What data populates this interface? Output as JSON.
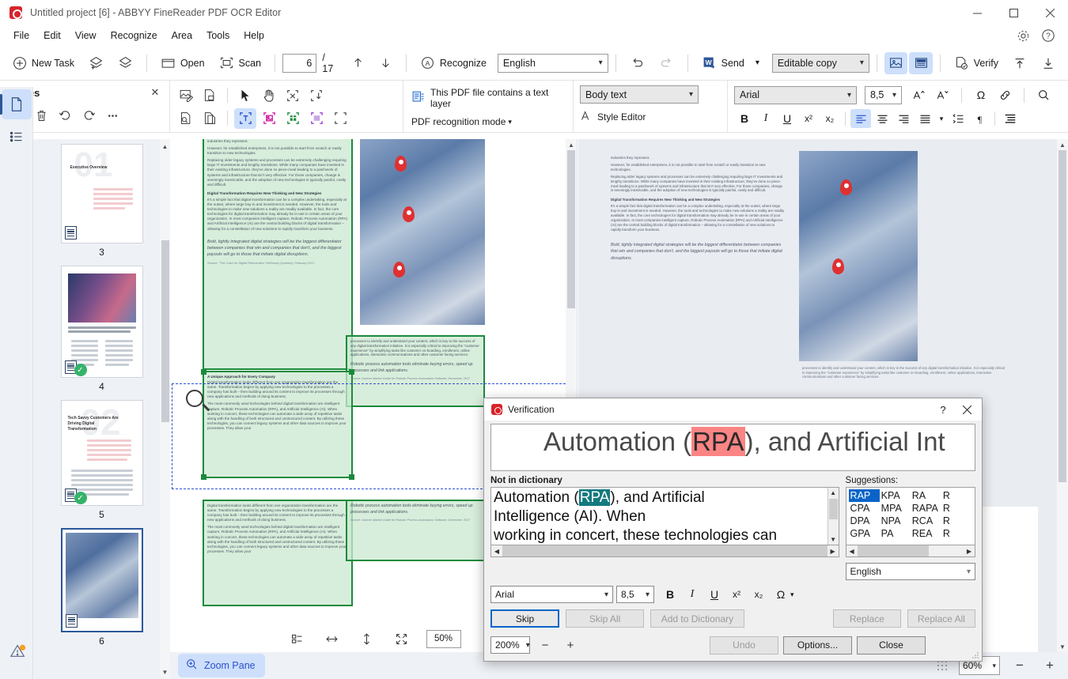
{
  "window": {
    "title": "Untitled project [6] - ABBYY FineReader PDF OCR Editor",
    "minimize": "─",
    "maximize": "☐",
    "close": "✕"
  },
  "menubar": {
    "items": [
      "File",
      "Edit",
      "View",
      "Recognize",
      "Area",
      "Tools",
      "Help"
    ],
    "settings_icon": "gear-icon",
    "help_icon": "help-icon"
  },
  "toolbar": {
    "new_task": "New Task",
    "open": "Open",
    "scan": "Scan",
    "page_current": "6",
    "page_total": "/ 17",
    "recognize": "Recognize",
    "language": "English",
    "send": "Send",
    "export_mode": "Editable copy",
    "verify": "Verify"
  },
  "panels": {
    "pages": {
      "title": "Pages",
      "close": "✕",
      "thumbnails": [
        {
          "number": "3",
          "title": "Executive Overview",
          "big_digit": "01",
          "verified": false
        },
        {
          "number": "4",
          "title": "",
          "big_digit": "",
          "verified": true
        },
        {
          "number": "5",
          "title": "Tech Savvy Customers Are Driving Digital Transformation",
          "big_digit": "02",
          "verified": true
        },
        {
          "number": "6",
          "title": "",
          "big_digit": "",
          "verified": false,
          "selected": true
        }
      ]
    },
    "pdf_mode": {
      "text_layer_note": "This PDF file contains a text layer",
      "recognition_mode": "PDF recognition mode"
    },
    "style": {
      "style_name": "Body text",
      "style_editor": "Style Editor"
    },
    "format": {
      "font": "Arial",
      "size": "8,5",
      "bold": "B",
      "italic": "I",
      "underline": "U",
      "superscript": "x²",
      "subscript": "x₂",
      "symbol": "Ω",
      "link": "link-icon",
      "search": "search-icon"
    },
    "image_toolbar": {
      "zoom": "50%"
    }
  },
  "document": {
    "left_page_text": [
      "industries they represent.",
      "However, for established enterprises, it is not possible to start from scratch or easily transition to new technologies.",
      "Replacing older legacy systems and processes can be extremely challenging requiring large IT investments and lengthy transitions. While many companies have invested in their existing infrastructure, they've done so piece-meal leading to a patchwork of systems and infrastructure that isn't very effective. For those companies, change is seemingly inextricable, and the adoption of new technologies is typically painful, costly and difficult."
    ],
    "heading_1": "Digital Transformation Requires New Thinking and New Strategies",
    "body_1": "It's a simple fact that digital transformation can be a complex undertaking, especially at the outset, where large buy-in and investment is needed. However, the tools and technologies to make new solutions a reality are readily available. In fact, the core technologies for digital transformation may already be in-use in certain areas of your organization. In most companies intelligent capture, Robotic Process Automation (RPA) and Artificial Intelligence (AI) are the central building blocks of digital transformation – allowing for a constellation of new solutions to rapidly transform your business.",
    "quote_1": "Bold, tightly integrated digital strategies will be the biggest differentiator between companies that win and companies that don't, and the biggest payouts will go to those that initiate digital disruptions.",
    "source_1": "Source: \"The Case for Digital Reinvention\" McKinsey Quarterly, February 2017.",
    "heading_2": "A Unique Approach for Every Company",
    "body_2": "Digital transformation looks different from one organization transformation are the same. Transformation begins by applying new technologies to the processes a company has built – then building around its content to improve its processes through new applications and methods of doing business.",
    "body_3": "The most commonly used technologies behind digital transformation are intelligent capture, Robotic Process Automation (RPA), and Artificial Intelligence (AI). When working in concert, these technologies can automate a wide array of repetitive tasks along with the handling of both structured and unstructured content. By utilizing these technologies, you can connect legacy systems and other data sources to improve your processes. They allow your",
    "body_4": "processes to identify and understand your content, which is key to the success of any digital transformation initiative. It is especially critical to improving the \"customer experience\" by simplifying tasks like customer on-boarding, enrollment, online applications, interactive communications and other customer facing services.",
    "quote_2": "Robotic process automation tools eliminate keying errors, speed up processes and link applications.",
    "source_2": "Source: Gartner Market Guide for Robotic Process Automation Software, December, 2017"
  },
  "dialog": {
    "title": "Verification",
    "help": "?",
    "close": "✕",
    "preview_before": "Automation (",
    "preview_word": "RPA",
    "preview_after": "), and Artificial Int",
    "not_in_dictionary_label": "Not in dictionary",
    "nd_line1_a": "Automation (",
    "nd_line1_word": "RPA",
    "nd_line1_b": "), and Artificial",
    "nd_line2": "Intelligence (AI). When",
    "nd_line3": "working in concert, these technologies can",
    "suggestions_label": "Suggestions:",
    "suggestions": [
      "RAP",
      "KPA",
      "RA",
      "R",
      "CPA",
      "MPA",
      "RAPA",
      "R",
      "DPA",
      "NPA",
      "RCA",
      "R",
      "GPA",
      "PA",
      "REA",
      "R"
    ],
    "selected_suggestion": "RAP",
    "language": "English",
    "font": "Arial",
    "font_size": "8,5",
    "bold": "B",
    "italic": "I",
    "underline": "U",
    "superscript": "x²",
    "subscript": "x₂",
    "symbol": "Ω",
    "skip": "Skip",
    "skip_all": "Skip All",
    "add_to_dictionary": "Add to Dictionary",
    "replace": "Replace",
    "replace_all": "Replace All",
    "zoom": "200%",
    "minus": "−",
    "plus": "+",
    "undo": "Undo",
    "options": "Options...",
    "close_btn": "Close"
  },
  "bottombar": {
    "zoom_pane": "Zoom Pane",
    "zoom_level": "60%",
    "minus": "−",
    "plus": "+"
  }
}
